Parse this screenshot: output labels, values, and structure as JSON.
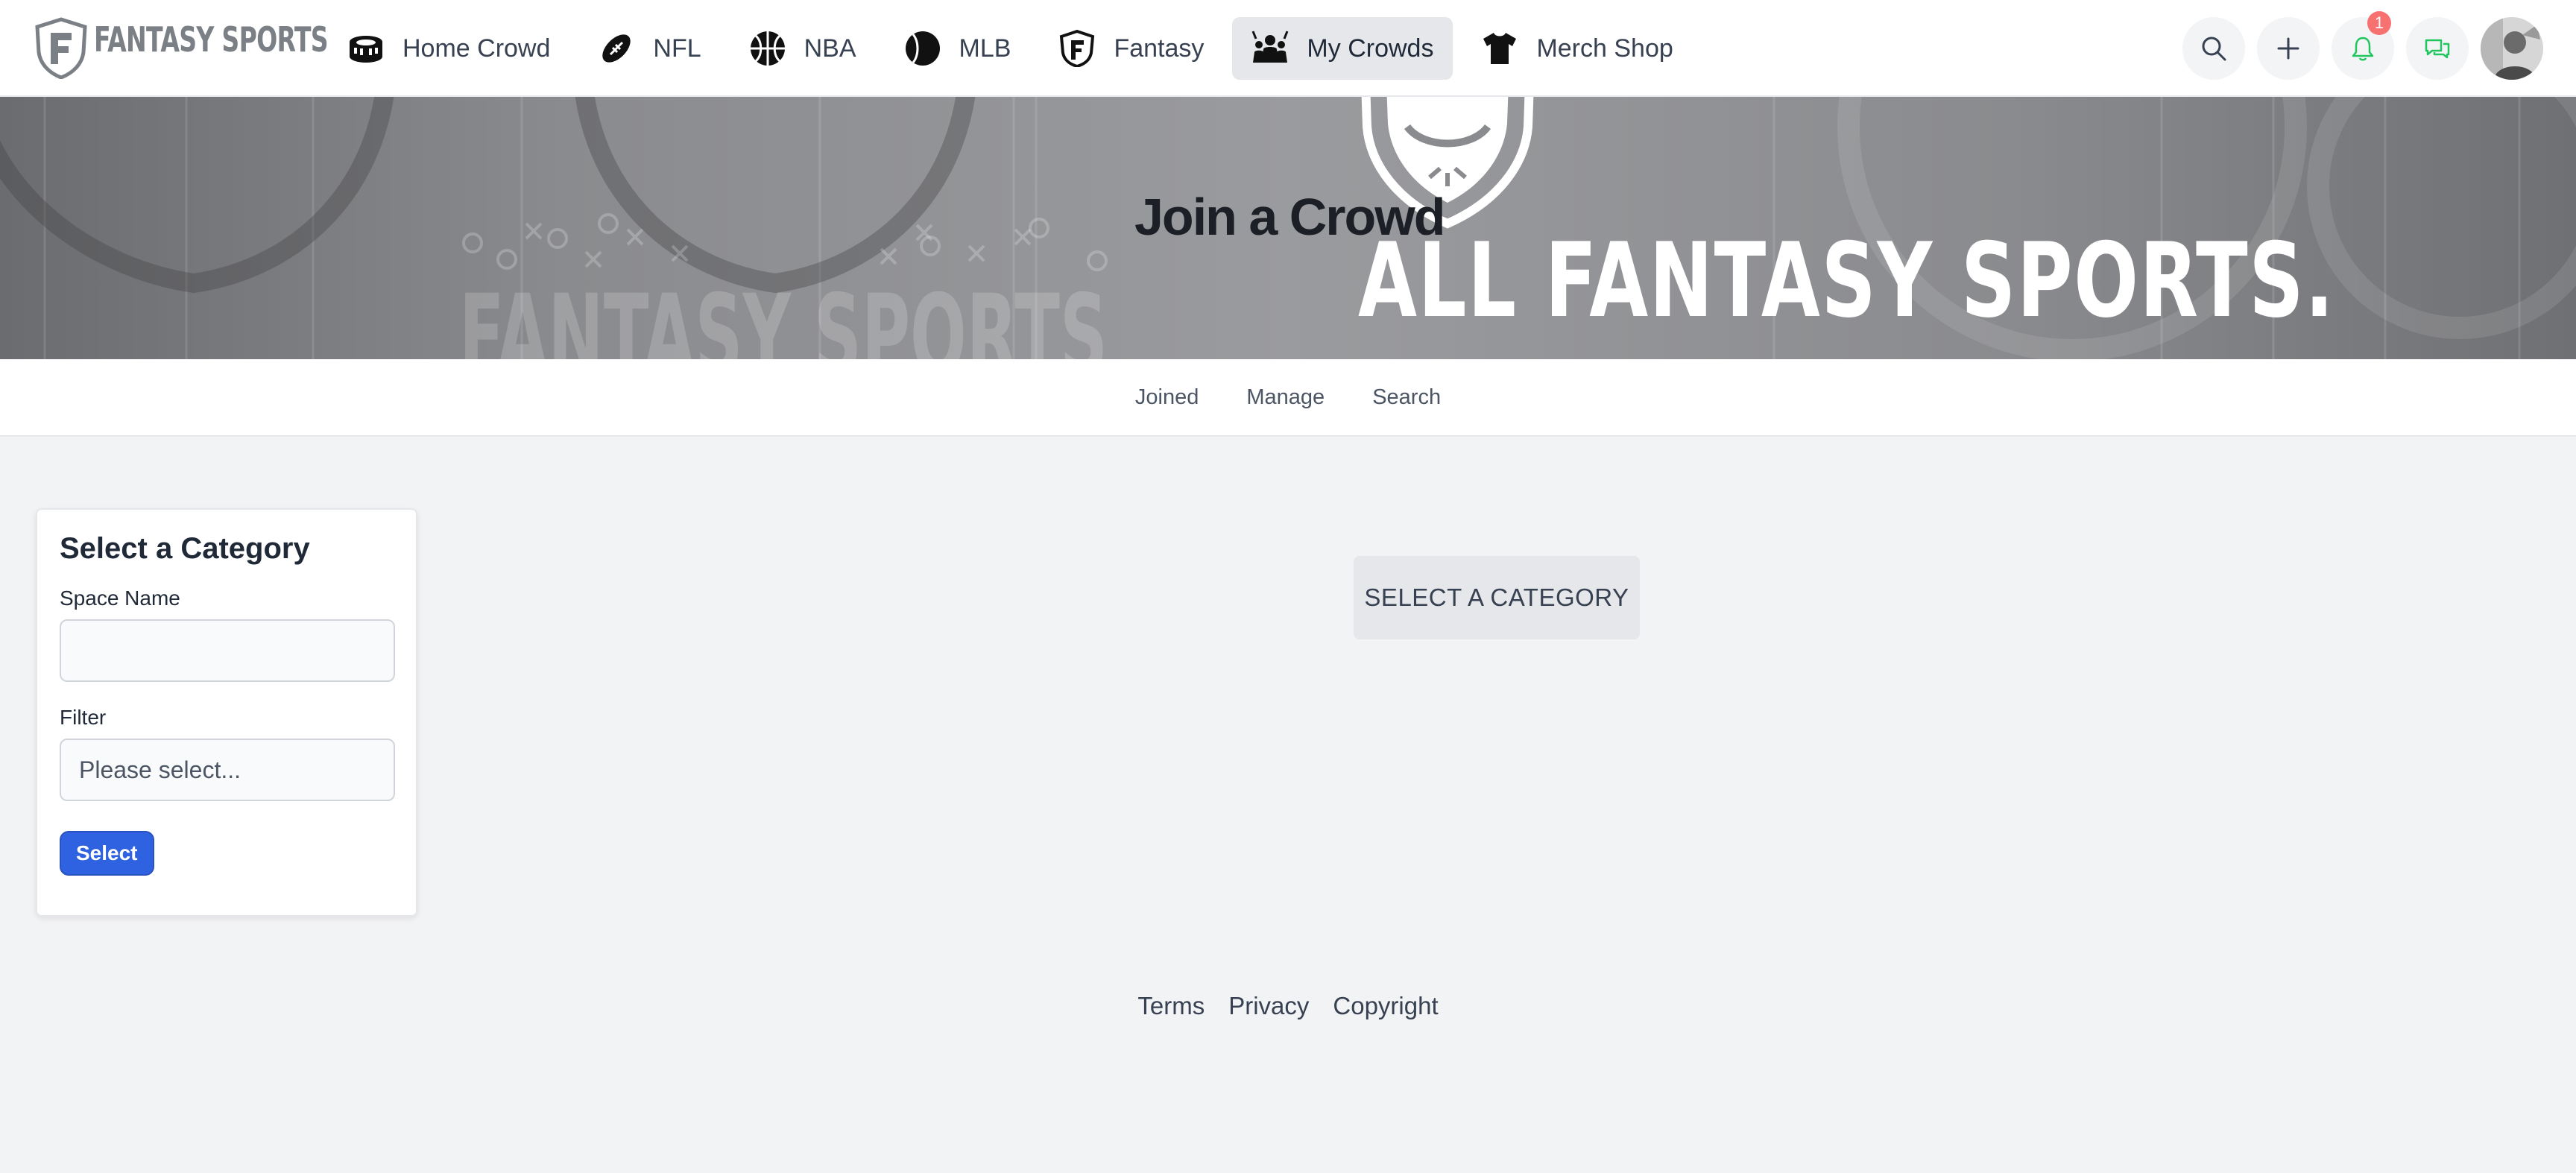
{
  "brand": {
    "name": "FANTASY SPORTS"
  },
  "nav": {
    "items": [
      {
        "label": "Home Crowd",
        "icon": "stadium-icon"
      },
      {
        "label": "NFL",
        "icon": "football-icon"
      },
      {
        "label": "NBA",
        "icon": "basketball-icon"
      },
      {
        "label": "MLB",
        "icon": "baseball-icon"
      },
      {
        "label": "Fantasy",
        "icon": "fantasy-shield-icon"
      },
      {
        "label": "My Crowds",
        "icon": "crowd-icon",
        "active": true
      },
      {
        "label": "Merch Shop",
        "icon": "tshirt-icon"
      }
    ],
    "actions": [
      {
        "name": "search",
        "icon": "search-icon"
      },
      {
        "name": "create",
        "icon": "plus-icon"
      },
      {
        "name": "notifications",
        "icon": "bell-icon",
        "badge": "1"
      },
      {
        "name": "messages",
        "icon": "chat-icon"
      }
    ],
    "accent_green": "#22c55e"
  },
  "banner": {
    "heading": "Join a Crowd",
    "tagline": "ALL FANTASY SPORTS.",
    "watermark": "FANTASY SPORTS"
  },
  "subnav": {
    "links": [
      "Joined",
      "Manage",
      "Search"
    ]
  },
  "category_form": {
    "title": "Select a Category",
    "space_name_label": "Space Name",
    "space_name_value": "",
    "filter_label": "Filter",
    "filter_placeholder": "Please select...",
    "submit_label": "Select",
    "button_color": "#2f62e0"
  },
  "main": {
    "placeholder": "SELECT A CATEGORY"
  },
  "footer": {
    "links": [
      "Terms",
      "Privacy",
      "Copyright"
    ]
  }
}
